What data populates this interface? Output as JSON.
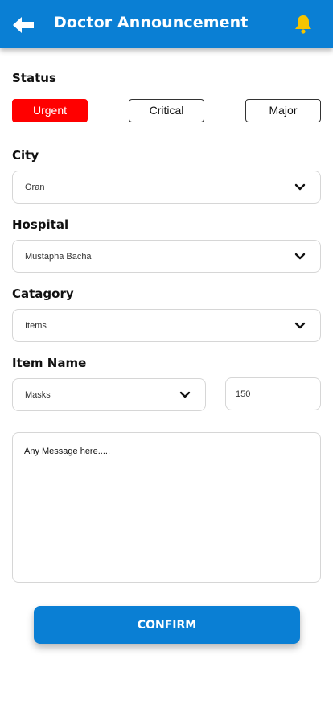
{
  "header": {
    "title": "Doctor Announcement",
    "back_icon": "arrow-left-icon",
    "notification_icon": "bell-icon",
    "brand_color": "#0a7fd4",
    "bell_color": "#f5c400"
  },
  "status": {
    "label": "Status",
    "options": [
      "Urgent",
      "Critical",
      "Major"
    ],
    "selected": "Urgent",
    "selected_color": "#ff0000"
  },
  "city": {
    "label": "City",
    "value": "Oran"
  },
  "hospital": {
    "label": "Hospital",
    "value": "Mustapha Bacha"
  },
  "category": {
    "label": "Catagory",
    "value": "Items"
  },
  "item": {
    "label": "Item Name",
    "value": "Masks",
    "quantity": "150"
  },
  "message": {
    "placeholder": "Any Message here....."
  },
  "confirm": {
    "label": "CONFIRM"
  },
  "icons": {
    "dropdown": "chevron-down-icon"
  }
}
